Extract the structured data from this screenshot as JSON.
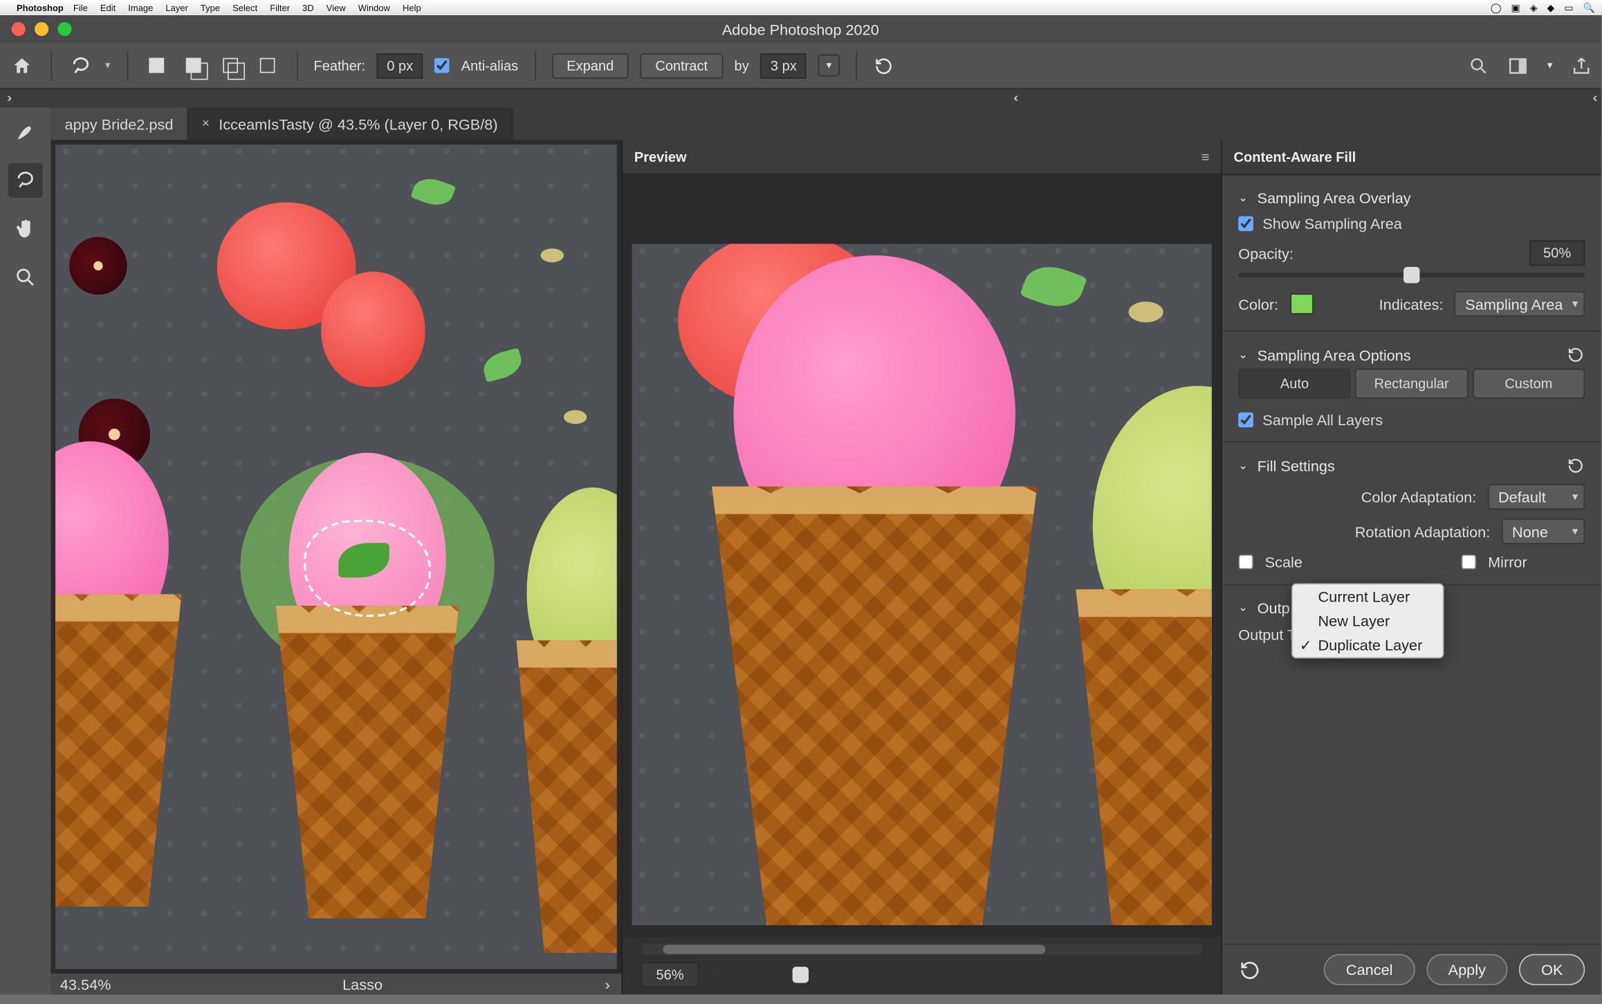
{
  "menubar": {
    "app": "Photoshop",
    "items": [
      "File",
      "Edit",
      "Image",
      "Layer",
      "Type",
      "Select",
      "Filter",
      "3D",
      "View",
      "Window",
      "Help"
    ]
  },
  "window_title": "Adobe Photoshop 2020",
  "optionsbar": {
    "feather_label": "Feather:",
    "feather_value": "0 px",
    "antialias_label": "Anti-alias",
    "expand_label": "Expand",
    "contract_label": "Contract",
    "by_label": "by",
    "by_value": "3 px"
  },
  "tabs": {
    "inactive": "appy Bride2.psd",
    "active": "IcceamIsTasty @ 43.5% (Layer 0, RGB/8)"
  },
  "statusbar": {
    "zoom": "43.54%",
    "tool": "Lasso"
  },
  "preview_panel": {
    "title": "Preview",
    "zoom_value": "56%",
    "slider_pos_pct": 18
  },
  "inspector": {
    "title": "Content-Aware Fill",
    "sampling_overlay": {
      "heading": "Sampling Area Overlay",
      "show_label": "Show Sampling Area",
      "opacity_label": "Opacity:",
      "opacity_value": "50%",
      "opacity_slider_pct": 50,
      "color_label": "Color:",
      "color_hex": "#7ed757",
      "indicates_label": "Indicates:",
      "indicates_value": "Sampling Area"
    },
    "sampling_options": {
      "heading": "Sampling Area Options",
      "segments": [
        "Auto",
        "Rectangular",
        "Custom"
      ],
      "selected": "Auto",
      "sample_all_layers_label": "Sample All Layers"
    },
    "fill_settings": {
      "heading": "Fill Settings",
      "color_adapt_label": "Color Adaptation:",
      "color_adapt_value": "Default",
      "rotation_label": "Rotation Adaptation:",
      "rotation_value": "None",
      "scale_label": "Scale",
      "mirror_label": "Mirror"
    },
    "output": {
      "heading": "Outp",
      "output_to_label": "Output T",
      "menu": [
        "Current Layer",
        "New Layer",
        "Duplicate Layer"
      ],
      "menu_selected": "Duplicate Layer"
    }
  },
  "actions": {
    "cancel": "Cancel",
    "apply": "Apply",
    "ok": "OK"
  }
}
